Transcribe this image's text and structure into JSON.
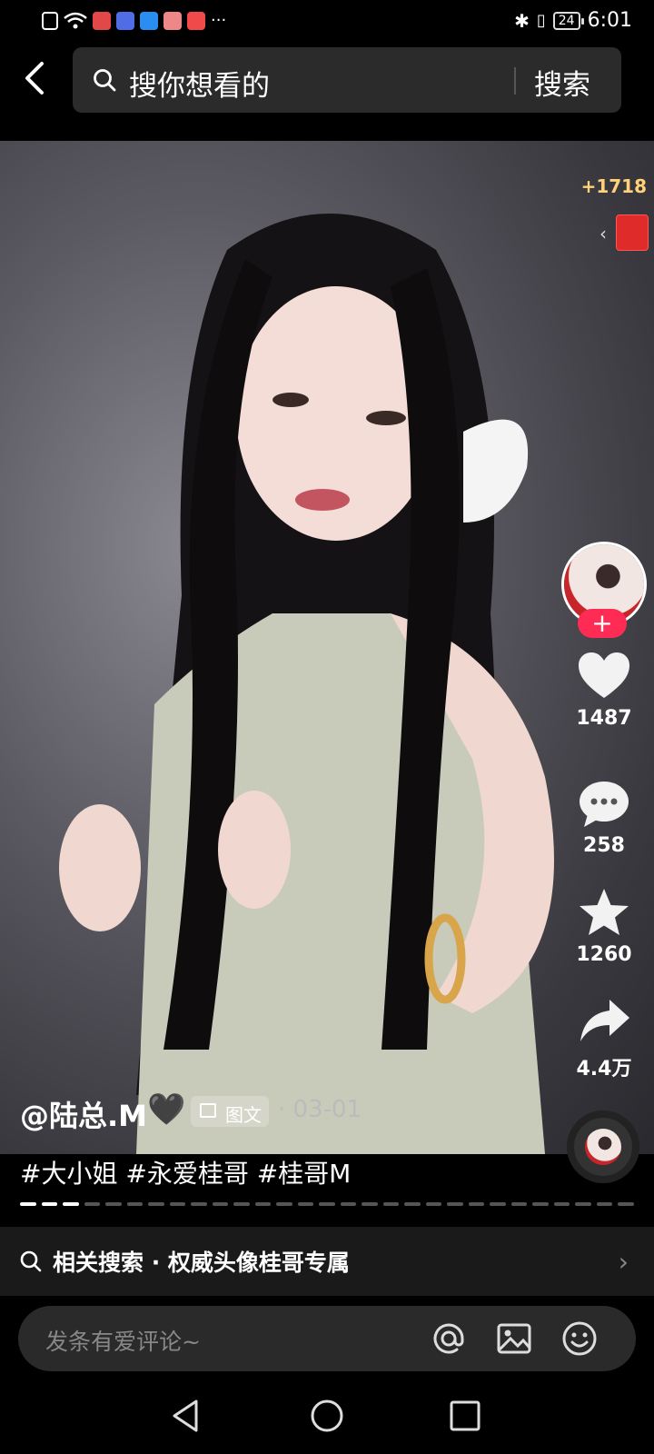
{
  "status_bar": {
    "time": "6:01",
    "battery": "24",
    "notification_more": "···"
  },
  "header": {
    "search_placeholder": "搜你想看的",
    "search_button": "搜索"
  },
  "rewards": {
    "points": "+1718"
  },
  "rail": {
    "follow_label": "+",
    "likes": "1487",
    "comments": "258",
    "favorites": "1260",
    "shares": "4.4万"
  },
  "post": {
    "author": "@陆总.M",
    "author_emoji": "🖤",
    "type_tag": "图文",
    "date": "· 03-01",
    "hashtags": "#大小姐 #永爱桂哥 #桂哥M",
    "progress_total": 29,
    "progress_current": 3
  },
  "related_search": {
    "label": "相关搜索 · 权威头像桂哥专属",
    "arrow": "›"
  },
  "comment_bar": {
    "placeholder": "发条有爱评论~"
  },
  "colors": {
    "accent": "#fe2c55",
    "reward": "#ffd27a",
    "redpacket": "#e02b2b"
  }
}
